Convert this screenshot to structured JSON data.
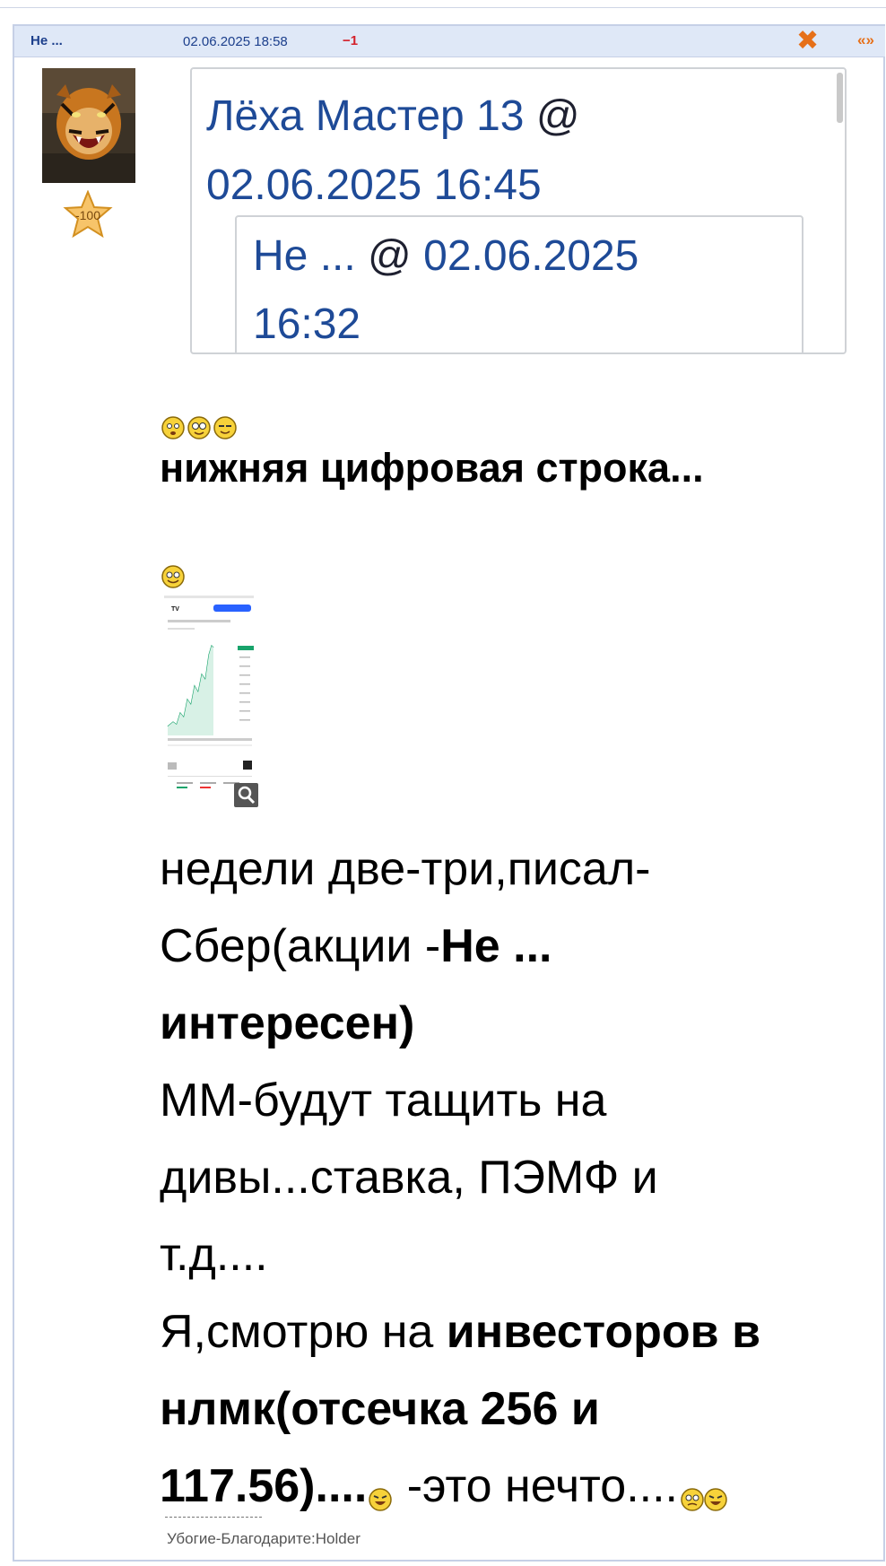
{
  "header": {
    "author": "Не ...",
    "datetime": "02.06.2025 18:58",
    "rating": "−1",
    "close_icon": "✖",
    "quote_icon": "«»"
  },
  "user": {
    "avatar": "tiger-avatar",
    "karma": "-100"
  },
  "quote": {
    "author": "Лёха Мастер 13",
    "at": "@",
    "datetime": "02.06.2025 16:45",
    "nested": {
      "author": "Не ...",
      "at": "@",
      "datetime_date": "02.06.2025",
      "datetime_time": "16:32"
    }
  },
  "post": {
    "heading": "нижняя цифровая строка...",
    "line1": "недели две-три,писал-",
    "line2_a": "Сбер(акции -",
    "line2_b": "Не ...",
    "line3": "интересен)",
    "line4": "ММ-будут тащить на",
    "line5": "дивы...ставка, ПЭМФ и",
    "line6": "т.д....",
    "line7_a": "Я,смотрю на ",
    "line7_b": "инвесторов в",
    "line8": "нлмк(отсечка 256 и",
    "line9_a": "117.56)....",
    "line9_b": " -это нечто...."
  },
  "thumbnail": {
    "logo": "TV",
    "icon": "zoom-icon"
  },
  "signature": "Убогие-Благодарите:Holder",
  "colors": {
    "header_bg": "#dfe8f7",
    "link_blue": "#1e4a97",
    "accent_orange": "#e67019",
    "rating_red": "#d4202a"
  }
}
